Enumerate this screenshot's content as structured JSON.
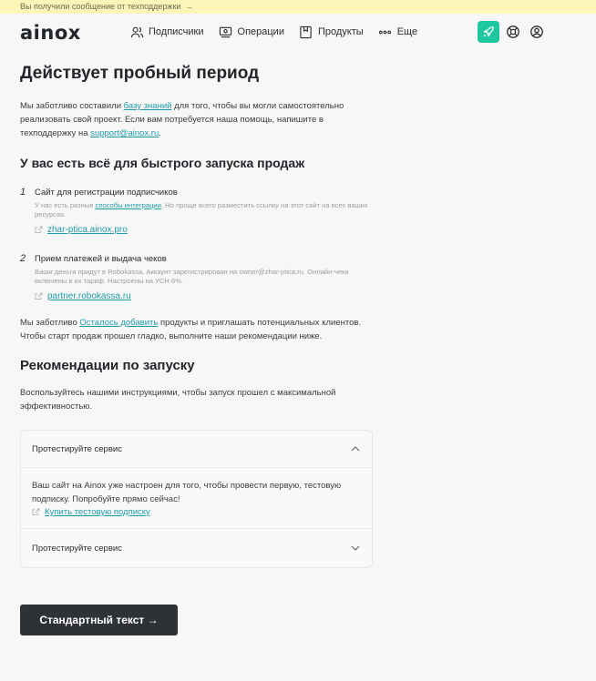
{
  "notice": {
    "text": "Вы получили сообщение от техподдержки",
    "arrow": "→"
  },
  "header": {
    "logo": "ainox",
    "nav": [
      {
        "label": "Подписчики",
        "icon": "users-icon"
      },
      {
        "label": "Операции",
        "icon": "operations-icon"
      },
      {
        "label": "Продукты",
        "icon": "products-icon"
      },
      {
        "label": "Еще",
        "icon": "more-icon"
      }
    ],
    "accent": "#1ec7a0"
  },
  "main": {
    "title": "Действует пробный период",
    "intro": {
      "before": "Мы заботливо составили ",
      "link": "базу знаний",
      "middle": " для того, чтобы вы могли самостоятельно реализовать свой проект. Если вам потребуется наша помощь, напишите в техподдержку на ",
      "email": "support@ainox.ru",
      "after": "."
    },
    "section1_title": "У вас есть всё для быстрого запуска продаж",
    "steps": [
      {
        "num": "1",
        "title": "Сайт для регистрации подписчиков",
        "desc_before": "У нас есть разные ",
        "desc_link": "способы интеграции",
        "desc_after": ". Но проще всего разместить ссылку на этот сайт на всех ваших ресурсах.",
        "link": "zhar-ptica.ainox.pro"
      },
      {
        "num": "2",
        "title": "Прием платежей и выдача чеков",
        "desc": "Ваши деньги придут в Robokassa. Аккаунт зарегистрирован на owner@zhar-ptica.ru. Онлайн-чеки включены в их тариф. Настроены на УСН 6%.",
        "link": "partner.robokassa.ru"
      }
    ],
    "after_steps": {
      "before": "Мы заботливо ",
      "link": "Осталось добавить",
      "after": " продукты и приглашать потенциальных клиентов. Чтобы старт продаж прошел гладко, выполните наши рекомендации ниже."
    },
    "section2_title": "Рекомендации по запуску",
    "section2_text": "Воспользуйтесь нашими инструкциями, чтобы запуск прошел с максимальной эффективностью.",
    "accordion": [
      {
        "title": "Протестируйте сервис",
        "expanded": true,
        "body": "Ваш сайт на Ainox уже настроен для того, чтобы провести первую, тестовую подписку. Попробуйте прямо сейчас!",
        "link": "Купить тестовую подписку"
      },
      {
        "title": "Протестируйте сервис",
        "expanded": false
      }
    ],
    "cta": "Стандартный текст →"
  }
}
